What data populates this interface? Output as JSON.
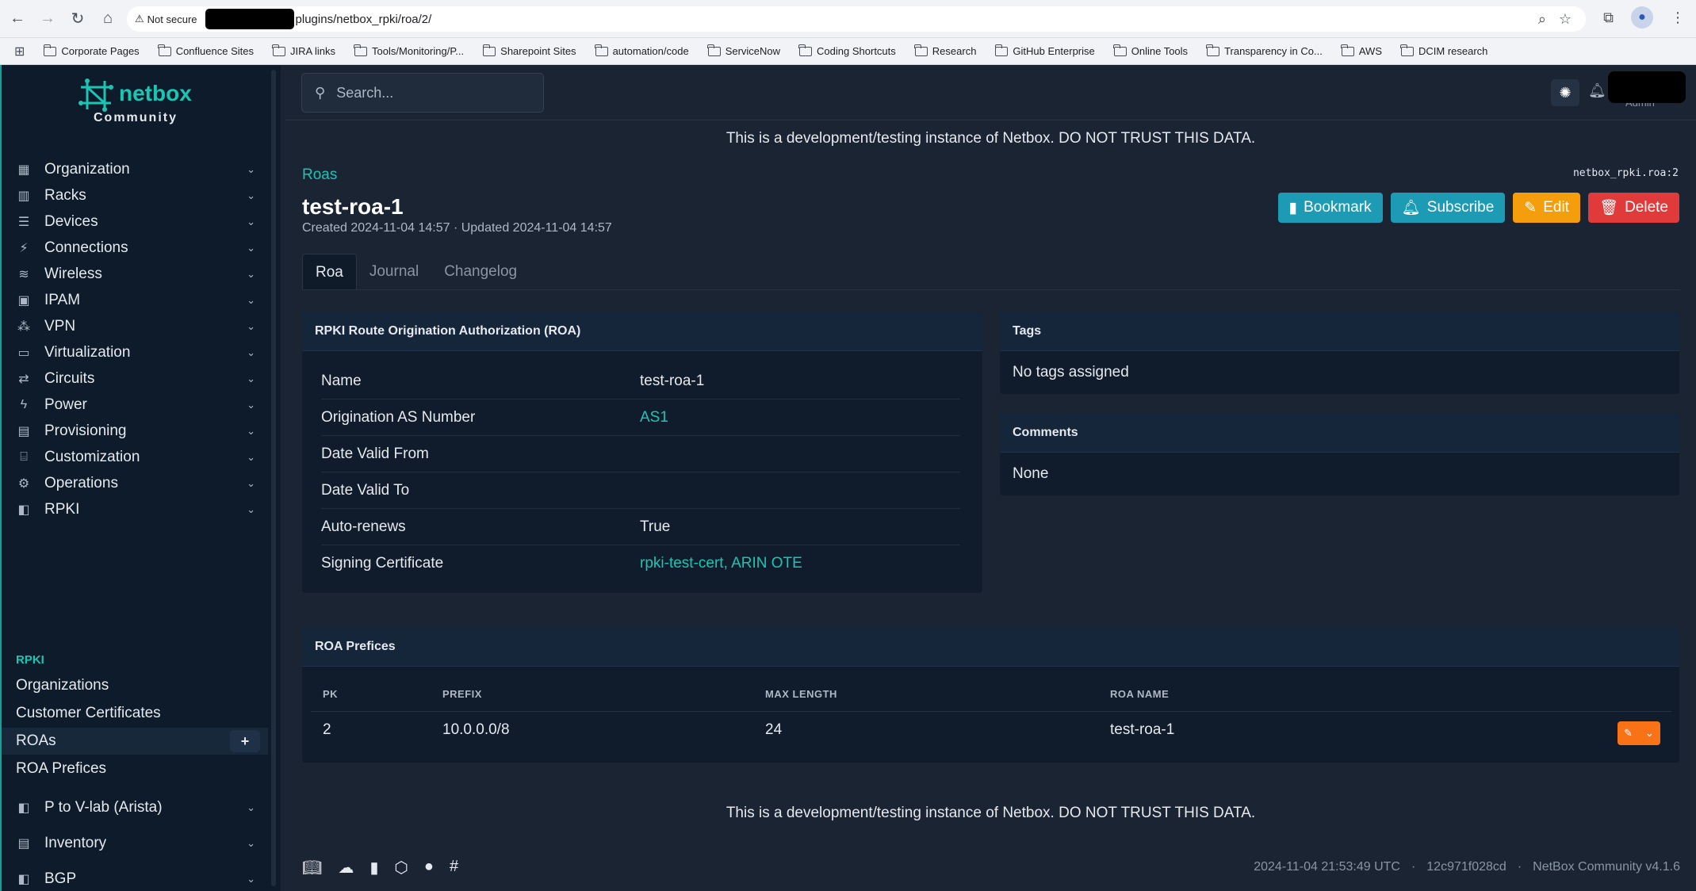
{
  "browser": {
    "security_label": "Not secure",
    "url": "plugins/netbox_rpki/roa/2/",
    "bookmarks": [
      "Corporate Pages",
      "Confluence Sites",
      "JIRA links",
      "Tools/Monitoring/P...",
      "Sharepoint Sites",
      "automation/code",
      "ServiceNow",
      "Coding Shortcuts",
      "Research",
      "GitHub Enterprise",
      "Online Tools",
      "Transparency in Co...",
      "AWS",
      "DCIM research"
    ]
  },
  "sidebar": {
    "logo_word": "netbox",
    "logo_sub": "Community",
    "menu": [
      "Organization",
      "Racks",
      "Devices",
      "Connections",
      "Wireless",
      "IPAM",
      "VPN",
      "Virtualization",
      "Circuits",
      "Power",
      "Provisioning",
      "Customization",
      "Operations",
      "RPKI"
    ],
    "rpki_heading": "RPKI",
    "rpki_items": [
      "Organizations",
      "Customer Certificates",
      "ROAs",
      "ROA Prefices"
    ],
    "add_symbol": "+",
    "menu_after": [
      "P to V-lab (Arista)",
      "Inventory",
      "BGP"
    ]
  },
  "topbar": {
    "search_placeholder": "Search...",
    "user_label": "Admin"
  },
  "banner_text": "This is a development/testing instance of Netbox. DO NOT TRUST THIS DATA.",
  "header": {
    "breadcrumb": "Roas",
    "object_id": "netbox_rpki.roa:2",
    "title": "test-roa-1",
    "meta": "Created 2024-11-04 14:57 · Updated 2024-11-04 14:57",
    "actions": {
      "bookmark": "Bookmark",
      "subscribe": "Subscribe",
      "edit": "Edit",
      "delete": "Delete"
    }
  },
  "tabs": [
    "Roa",
    "Journal",
    "Changelog"
  ],
  "roa_card": {
    "title": "RPKI Route Origination Authorization (ROA)",
    "rows": [
      {
        "key": "Name",
        "value": "test-roa-1"
      },
      {
        "key": "Origination AS Number",
        "value": "AS1"
      },
      {
        "key": "Date Valid From",
        "value": ""
      },
      {
        "key": "Date Valid To",
        "value": ""
      },
      {
        "key": "Auto-renews",
        "value": "True"
      },
      {
        "key": "Signing Certificate",
        "value": "rpki-test-cert, ARIN OTE"
      }
    ]
  },
  "tags_card": {
    "title": "Tags",
    "body": "No tags assigned"
  },
  "comments_card": {
    "title": "Comments",
    "body": "None"
  },
  "prefixes_card": {
    "title": "ROA Prefices",
    "columns": [
      "PK",
      "PREFIX",
      "MAX LENGTH",
      "ROA NAME"
    ],
    "rows": [
      {
        "pk": "2",
        "prefix": "10.0.0.0/8",
        "max_length": "24",
        "roa_name": "test-roa-1"
      }
    ]
  },
  "footer": {
    "timestamp": "2024-11-04 21:53:49 UTC",
    "commit": "12c971f028cd",
    "version": "NetBox Community v4.1.6",
    "separator": "·"
  }
}
